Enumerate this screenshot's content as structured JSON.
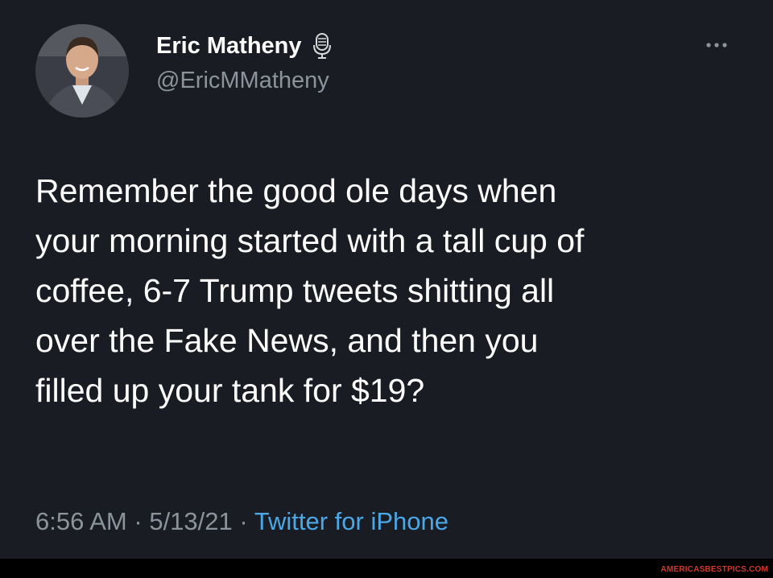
{
  "tweet": {
    "author": {
      "display_name": "Eric Matheny",
      "handle": "@EricMMatheny",
      "badge_icon": "microphone-icon",
      "avatar_icon": "profile-photo"
    },
    "more_icon": "more-options-icon",
    "body_lines": [
      "Remember the good ole days when",
      "your morning started with a tall cup of",
      "coffee, 6-7 Trump tweets shitting all",
      "over the Fake News, and then you",
      "filled up your tank for $19?"
    ],
    "meta": {
      "time": "6:56 AM",
      "separator1": "·",
      "date": "5/13/21",
      "separator2": "·",
      "source": "Twitter for iPhone"
    }
  },
  "watermark": "AMERICASBESTPICS.COM",
  "colors": {
    "background": "#1a1c24",
    "text_primary": "#ffffff",
    "text_secondary": "#8b949c",
    "link": "#4aa8e6",
    "watermark": "#d0382c"
  }
}
